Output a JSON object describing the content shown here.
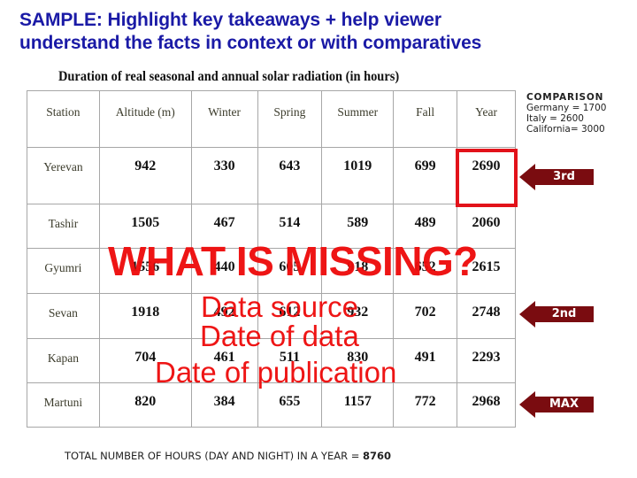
{
  "headline": {
    "line1": "SAMPLE: Highlight key takeaways + help viewer",
    "line2": "understand the facts in context or with comparatives"
  },
  "table": {
    "title": "Duration of real seasonal and annual solar radiation (in hours)",
    "headers": [
      "Station",
      "Altitude (m)",
      "Winter",
      "Spring",
      "Summer",
      "Fall",
      "Year"
    ],
    "rows": [
      {
        "station": "Yerevan",
        "values": [
          "942",
          "330",
          "643",
          "1019",
          "699",
          "2690"
        ]
      },
      {
        "station": "Tashir",
        "values": [
          "1505",
          "467",
          "514",
          "589",
          "489",
          "2060"
        ]
      },
      {
        "station": "Gyumri",
        "values": [
          "1556",
          "440",
          "605",
          "918",
          "652",
          "2615"
        ]
      },
      {
        "station": "Sevan",
        "values": [
          "1918",
          "492",
          "612",
          "932",
          "702",
          "2748"
        ]
      },
      {
        "station": "Kapan",
        "values": [
          "704",
          "461",
          "511",
          "830",
          "491",
          "2293"
        ]
      },
      {
        "station": "Martuni",
        "values": [
          "820",
          "384",
          "655",
          "1157",
          "772",
          "2968"
        ]
      }
    ],
    "highlight_color": "#e2121a"
  },
  "comparison": {
    "title": "COMPARISON",
    "lines": [
      "Germany = 1700",
      "Italy = 2600",
      "California= 3000"
    ]
  },
  "rank_arrows": [
    {
      "row": "Yerevan",
      "label": "3rd"
    },
    {
      "row": "Sevan",
      "label": "2nd"
    },
    {
      "row": "Martuni",
      "label": "MAX"
    }
  ],
  "overlay": {
    "question": "WHAT IS MISSING?",
    "items": [
      "Data source",
      "Date of data",
      "Date of publication"
    ],
    "color": "#ee0c0c"
  },
  "footer": {
    "text": "TOTAL NUMBER OF HOURS (DAY AND NIGHT) IN A YEAR = ",
    "value": "8760"
  }
}
